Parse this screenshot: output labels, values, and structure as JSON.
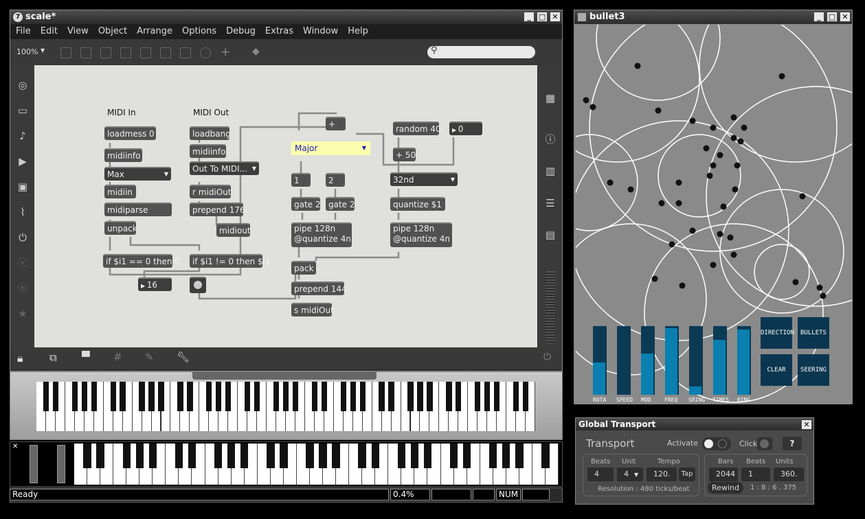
{
  "main_window": {
    "title": "scale*",
    "menu": [
      "File",
      "Edit",
      "View",
      "Object",
      "Arrange",
      "Options",
      "Debug",
      "Extras",
      "Window",
      "Help"
    ],
    "zoom": "100%"
  },
  "patch": {
    "comments": {
      "midi_in": "MIDI In",
      "midi_out": "MIDI Out"
    },
    "objects": {
      "loadmess": "loadmess 0",
      "midiinfo1": "midiinfo",
      "menu_max": "Max",
      "midiin": "midiin",
      "midiparse": "midiparse",
      "unpack": "unpack",
      "if1": "if $i1 == 0 then 0",
      "num16": "16",
      "loadbang": "loadbang",
      "midiinfo2": "midiinfo",
      "menu_out": "Out To MIDI...",
      "r_midiout": "r midiOut",
      "prepend176": "prepend 176",
      "midiout": "midiout",
      "if2": "if $i1 != 0 then $i1",
      "plus": "+",
      "major": "Major",
      "msg1": "1",
      "msg2": "2",
      "gate1": "gate 2",
      "gate2": "gate 2",
      "pipe1a": "pipe 128n",
      "pipe1b": "@quantize 4n",
      "pack": "pack",
      "prepend144": "prepend 144",
      "s_midiout": "s midiOut",
      "random": "random 40",
      "num0": "0",
      "plus50": "+ 50",
      "menu32": "32nd",
      "quantize": "quantize $1",
      "pipe2a": "pipe 128n",
      "pipe2b": "@quantize 4n"
    }
  },
  "bullet": {
    "title": "bullet3",
    "sliders": [
      {
        "label": "ROTA",
        "value": 0.47
      },
      {
        "label": "SPEED",
        "value": 0.0
      },
      {
        "label": "MOD",
        "value": 0.6
      },
      {
        "label": "FREQ",
        "value": 0.97
      },
      {
        "label": "SRING",
        "value": 0.12
      },
      {
        "label": "TIMES",
        "value": 0.8
      },
      {
        "label": "RING",
        "value": 0.95
      }
    ],
    "buttons": [
      "DIRECTION",
      "BULLETS",
      "CLEAR",
      "SEERING"
    ],
    "accent": "#0a7fb0"
  },
  "transport": {
    "title": "Global Transport",
    "heading": "Transport",
    "activate": "Activate",
    "click": "Click",
    "help": "?",
    "beats_lbl": "Beats",
    "unit_lbl": "Unit",
    "tempo_lbl": "Tempo",
    "beats": "4",
    "unit": "4",
    "tempo": "120.",
    "tap": "Tap",
    "resolution": "Resolution : 480 ticks/beat",
    "bars_lbl": "Bars",
    "beats2_lbl": "Beats",
    "units_lbl": "Units",
    "bars": "2044",
    "beats2": "1",
    "units": "360.",
    "rewind": "Rewind",
    "position": "1 : 8 : 6 . 375"
  },
  "status": {
    "text": "Ready",
    "cpu": "0.4%",
    "num": "NUM"
  }
}
